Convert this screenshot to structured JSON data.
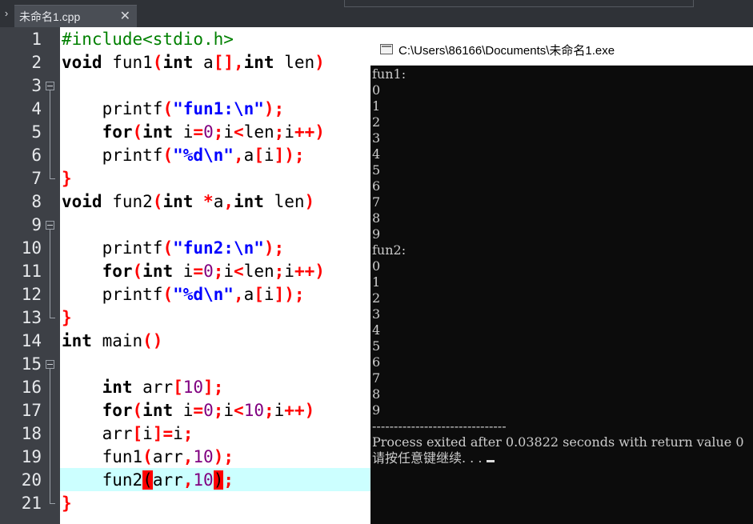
{
  "tabbar": {
    "nav_icon": "›",
    "tab_label": "未命名1.cpp",
    "close_icon": "✕"
  },
  "editor": {
    "line_numbers": [
      "1",
      "2",
      "3",
      "4",
      "5",
      "6",
      "7",
      "8",
      "9",
      "10",
      "11",
      "12",
      "13",
      "14",
      "15",
      "16",
      "17",
      "18",
      "19",
      "20",
      "21"
    ],
    "current_line": "20",
    "lines": [
      [
        [
          "pre",
          "#include<stdio.h>"
        ]
      ],
      [
        [
          "kw",
          "void"
        ],
        [
          "id",
          " fun1"
        ],
        [
          "pun",
          "("
        ],
        [
          "kw",
          "int"
        ],
        [
          "id",
          " a"
        ],
        [
          "pun",
          "[],"
        ],
        [
          "kw",
          "int"
        ],
        [
          "id",
          " len"
        ],
        [
          "pun",
          ")"
        ]
      ],
      [],
      [
        [
          "id",
          "    printf"
        ],
        [
          "pun",
          "("
        ],
        [
          "str",
          "\"fun1:\\n\""
        ],
        [
          "pun",
          ");"
        ]
      ],
      [
        [
          "id",
          "    "
        ],
        [
          "kw",
          "for"
        ],
        [
          "pun",
          "("
        ],
        [
          "kw",
          "int"
        ],
        [
          "id",
          " i"
        ],
        [
          "pun",
          "="
        ],
        [
          "num",
          "0"
        ],
        [
          "pun",
          ";"
        ],
        [
          "id",
          "i"
        ],
        [
          "pun",
          "<"
        ],
        [
          "id",
          "len"
        ],
        [
          "pun",
          ";"
        ],
        [
          "id",
          "i"
        ],
        [
          "pun",
          "++)"
        ]
      ],
      [
        [
          "id",
          "    printf"
        ],
        [
          "pun",
          "("
        ],
        [
          "str",
          "\"%d\\n\""
        ],
        [
          "pun",
          ","
        ],
        [
          "id",
          "a"
        ],
        [
          "pun",
          "["
        ],
        [
          "id",
          "i"
        ],
        [
          "pun",
          "]);"
        ]
      ],
      [
        [
          "pun",
          "}"
        ]
      ],
      [
        [
          "kw",
          "void"
        ],
        [
          "id",
          " fun2"
        ],
        [
          "pun",
          "("
        ],
        [
          "kw",
          "int"
        ],
        [
          "id",
          " "
        ],
        [
          "pun",
          "*"
        ],
        [
          "id",
          "a"
        ],
        [
          "pun",
          ","
        ],
        [
          "kw",
          "int"
        ],
        [
          "id",
          " len"
        ],
        [
          "pun",
          ")"
        ]
      ],
      [],
      [
        [
          "id",
          "    printf"
        ],
        [
          "pun",
          "("
        ],
        [
          "str",
          "\"fun2:\\n\""
        ],
        [
          "pun",
          ");"
        ]
      ],
      [
        [
          "id",
          "    "
        ],
        [
          "kw",
          "for"
        ],
        [
          "pun",
          "("
        ],
        [
          "kw",
          "int"
        ],
        [
          "id",
          " i"
        ],
        [
          "pun",
          "="
        ],
        [
          "num",
          "0"
        ],
        [
          "pun",
          ";"
        ],
        [
          "id",
          "i"
        ],
        [
          "pun",
          "<"
        ],
        [
          "id",
          "len"
        ],
        [
          "pun",
          ";"
        ],
        [
          "id",
          "i"
        ],
        [
          "pun",
          "++)"
        ]
      ],
      [
        [
          "id",
          "    printf"
        ],
        [
          "pun",
          "("
        ],
        [
          "str",
          "\"%d\\n\""
        ],
        [
          "pun",
          ","
        ],
        [
          "id",
          "a"
        ],
        [
          "pun",
          "["
        ],
        [
          "id",
          "i"
        ],
        [
          "pun",
          "]);"
        ]
      ],
      [
        [
          "pun",
          "}"
        ]
      ],
      [
        [
          "kw",
          "int"
        ],
        [
          "id",
          " main"
        ],
        [
          "pun",
          "()"
        ]
      ],
      [],
      [
        [
          "id",
          "    "
        ],
        [
          "kw",
          "int"
        ],
        [
          "id",
          " arr"
        ],
        [
          "pun",
          "["
        ],
        [
          "num",
          "10"
        ],
        [
          "pun",
          "];"
        ]
      ],
      [
        [
          "id",
          "    "
        ],
        [
          "kw",
          "for"
        ],
        [
          "pun",
          "("
        ],
        [
          "kw",
          "int"
        ],
        [
          "id",
          " i"
        ],
        [
          "pun",
          "="
        ],
        [
          "num",
          "0"
        ],
        [
          "pun",
          ";"
        ],
        [
          "id",
          "i"
        ],
        [
          "pun",
          "<"
        ],
        [
          "num",
          "10"
        ],
        [
          "pun",
          ";"
        ],
        [
          "id",
          "i"
        ],
        [
          "pun",
          "++)"
        ]
      ],
      [
        [
          "id",
          "    arr"
        ],
        [
          "pun",
          "["
        ],
        [
          "id",
          "i"
        ],
        [
          "pun",
          "]="
        ],
        [
          "id",
          "i"
        ],
        [
          "pun",
          ";"
        ]
      ],
      [
        [
          "id",
          "    fun1"
        ],
        [
          "pun",
          "("
        ],
        [
          "id",
          "arr"
        ],
        [
          "pun",
          ","
        ],
        [
          "num",
          "10"
        ],
        [
          "pun",
          ");"
        ]
      ],
      [
        [
          "id",
          "    fun2"
        ],
        [
          "brk",
          "("
        ],
        [
          "id",
          "arr"
        ],
        [
          "pun",
          ","
        ],
        [
          "num",
          "10"
        ],
        [
          "brk",
          ")"
        ],
        [
          "pun",
          ";"
        ]
      ],
      [
        [
          "pun",
          "}"
        ]
      ]
    ]
  },
  "console": {
    "title": "C:\\Users\\86166\\Documents\\未命名1.exe",
    "lines": [
      "fun1:",
      "0",
      "1",
      "2",
      "3",
      "4",
      "5",
      "6",
      "7",
      "8",
      "9",
      "fun2:",
      "0",
      "1",
      "2",
      "3",
      "4",
      "5",
      "6",
      "7",
      "8",
      "9",
      "",
      "",
      "-------------------------------",
      "Process exited after 0.03822 seconds with return value 0",
      "请按任意键继续. . . "
    ]
  }
}
